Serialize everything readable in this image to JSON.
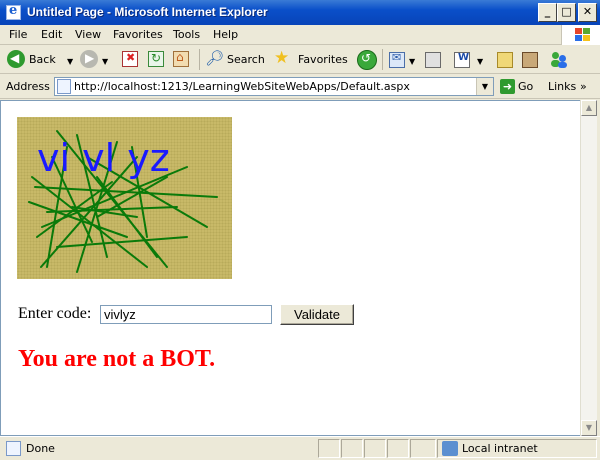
{
  "window": {
    "title": "Untitled Page - Microsoft Internet Explorer"
  },
  "menu": [
    "File",
    "Edit",
    "View",
    "Favorites",
    "Tools",
    "Help"
  ],
  "toolbar": {
    "back_label": "Back",
    "search_label": "Search",
    "favorites_label": "Favorites",
    "icons": [
      "back-icon",
      "forward-icon",
      "stop-icon",
      "refresh-icon",
      "home-icon",
      "search-icon",
      "favorites-icon",
      "history-icon",
      "mail-icon",
      "print-icon",
      "edit-icon",
      "discuss-icon",
      "research-icon",
      "messenger-icon"
    ]
  },
  "address": {
    "label": "Address",
    "url": "http://localhost:1213/LearningWebSiteWebApps/Default.aspx",
    "go_label": "Go",
    "links_label": "Links"
  },
  "page": {
    "captcha_text": "vi vl yz",
    "captcha_colors": {
      "background": "#c8b968",
      "text": "#1a1aff",
      "lines": "#0a7a0a"
    },
    "code_label": "Enter code:",
    "code_value": "vivlyz",
    "validate_label": "Validate",
    "result_message": "You are not a BOT."
  },
  "status": {
    "text": "Done",
    "zone": "Local intranet"
  }
}
